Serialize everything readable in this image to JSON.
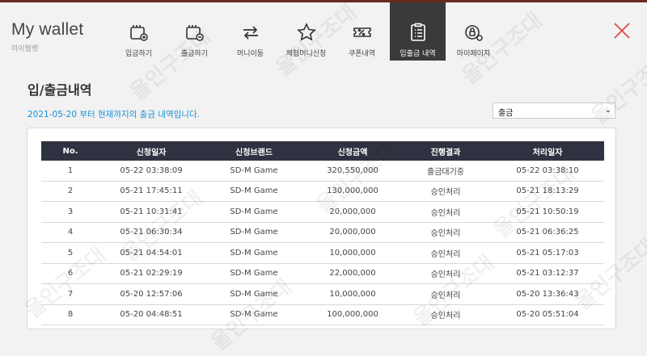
{
  "brand": {
    "title": "My wallet",
    "subtitle": "마이월렛"
  },
  "nav": [
    {
      "label": "입금하기",
      "icon": "deposit-wallet-icon",
      "active": false
    },
    {
      "label": "출금하기",
      "icon": "withdraw-wallet-icon",
      "active": false
    },
    {
      "label": "머니이동",
      "icon": "money-transfer-icon",
      "active": false
    },
    {
      "label": "체험머니신청",
      "icon": "star-icon",
      "active": false
    },
    {
      "label": "쿠폰내역",
      "icon": "coupon-icon",
      "active": false
    },
    {
      "label": "입출금 내역",
      "icon": "clipboard-list-icon",
      "active": true
    },
    {
      "label": "마이페이지",
      "icon": "lock-gear-icon",
      "active": false
    }
  ],
  "colors": {
    "accent_close": "#e04848",
    "active_nav": "#3a3a3a",
    "table_header": "#2f3341",
    "period_text": "#1a8fd6"
  },
  "page": {
    "title": "입/출금내역",
    "period_text": "2021-05-20 부터 현재까지의 출금 내역입니다.",
    "filter_selected": "출금"
  },
  "table": {
    "headers": [
      "No.",
      "신청일자",
      "신청브랜드",
      "신청금액",
      "진행결과",
      "처리일자"
    ],
    "rows": [
      [
        "1",
        "05-22 03:38:09",
        "SD-M Game",
        "320,550,000",
        "출금대기중",
        "05-22 03:38:10"
      ],
      [
        "2",
        "05-21 17:45:11",
        "SD-M Game",
        "130,000,000",
        "승인처리",
        "05-21 18:13:29"
      ],
      [
        "3",
        "05-21 10:31:41",
        "SD-M Game",
        "20,000,000",
        "승인처리",
        "05-21 10:50:19"
      ],
      [
        "4",
        "05-21 06:30:34",
        "SD-M Game",
        "20,000,000",
        "승인처리",
        "05-21 06:36:25"
      ],
      [
        "5",
        "05-21 04:54:01",
        "SD-M Game",
        "10,000,000",
        "승인처리",
        "05-21 05:17:03"
      ],
      [
        "6",
        "05-21 02:29:19",
        "SD-M Game",
        "22,000,000",
        "승인처리",
        "05-21 03:12:37"
      ],
      [
        "7",
        "05-20 12:57:06",
        "SD-M Game",
        "10,000,000",
        "승인처리",
        "05-20 13:36:43"
      ],
      [
        "8",
        "05-20 04:48:51",
        "SD-M Game",
        "100,000,000",
        "승인처리",
        "05-20 05:51:04"
      ]
    ]
  },
  "watermark": "올인구조대"
}
